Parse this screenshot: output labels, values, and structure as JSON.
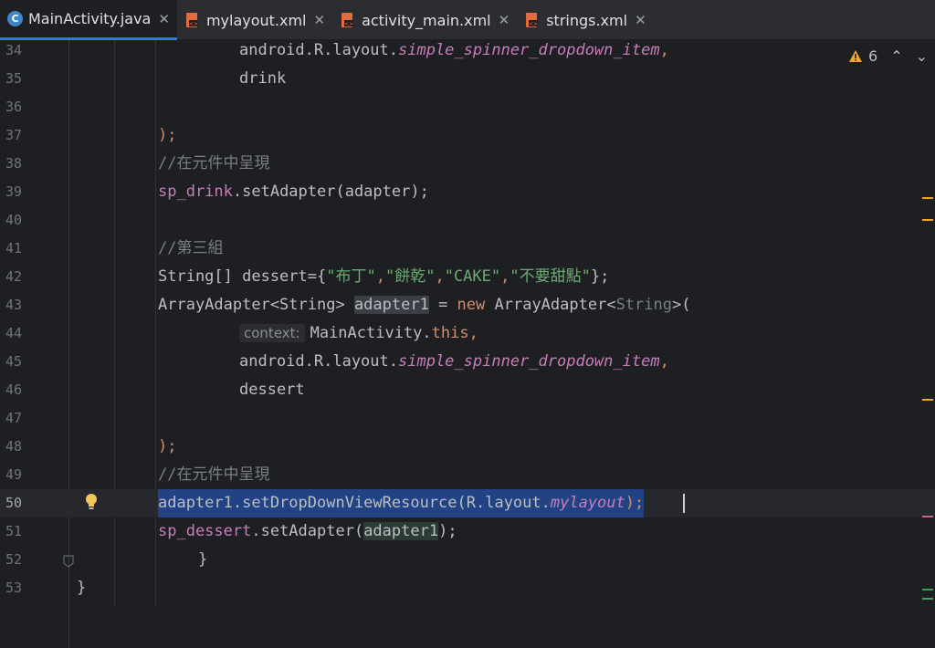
{
  "tabs": [
    {
      "label": "MainActivity.java",
      "type": "java",
      "active": true
    },
    {
      "label": "mylayout.xml",
      "type": "xml",
      "active": false
    },
    {
      "label": "activity_main.xml",
      "type": "xml",
      "active": false
    },
    {
      "label": "strings.xml",
      "type": "xml",
      "active": false
    }
  ],
  "inspections": {
    "warning_count": "6"
  },
  "lines": [
    {
      "num": "34"
    },
    {
      "num": "35"
    },
    {
      "num": "36"
    },
    {
      "num": "37"
    },
    {
      "num": "38"
    },
    {
      "num": "39"
    },
    {
      "num": "40"
    },
    {
      "num": "41"
    },
    {
      "num": "42"
    },
    {
      "num": "43"
    },
    {
      "num": "44"
    },
    {
      "num": "45"
    },
    {
      "num": "46"
    },
    {
      "num": "47"
    },
    {
      "num": "48"
    },
    {
      "num": "49"
    },
    {
      "num": "50"
    },
    {
      "num": "51"
    },
    {
      "num": "52"
    },
    {
      "num": "53"
    }
  ],
  "code": {
    "l34_a": "android.R.layout.",
    "l34_b": "simple_spinner_dropdown_item",
    "l34_c": ",",
    "l35": "drink",
    "l37": ");",
    "l38": "//在元件中呈現",
    "l39_a": "sp_drink",
    "l39_b": ".setAdapter(adapter);",
    "l41": "//第三組",
    "l42_a": "String[] dessert={",
    "l42_s1": "\"布丁\"",
    "l42_c1": ",",
    "l42_s2": "\"餅乾\"",
    "l42_c2": ",",
    "l42_s3": "\"CAKE\"",
    "l42_c3": ",",
    "l42_s4": "\"不要甜點\"",
    "l42_b": "};",
    "l43_a": "ArrayAdapter<String> ",
    "l43_v": "adapter1",
    "l43_b": " = ",
    "l43_kw": "new",
    "l43_c": " ArrayAdapter<",
    "l43_g": "String",
    "l43_d": ">(",
    "l44_hint": "context:",
    "l44_a": "MainActivity.",
    "l44_kw": "this",
    "l44_c": ",",
    "l45_a": "android.R.layout.",
    "l45_b": "simple_spinner_dropdown_item",
    "l45_c": ",",
    "l46": "dessert",
    "l48": ");",
    "l49": "//在元件中呈現",
    "l50_a": "adapter1.setDropDownViewResource(R.layout.",
    "l50_f": "mylayout",
    "l50_b": ");",
    "l51_a": "sp_dessert",
    "l51_b": ".setAdapter(",
    "l51_v": "adapter1",
    "l51_c": ");",
    "l52": "}",
    "l53": "}"
  },
  "colors": {
    "accent": "#3574f0",
    "selection": "#214283",
    "warning": "#f0a732"
  }
}
